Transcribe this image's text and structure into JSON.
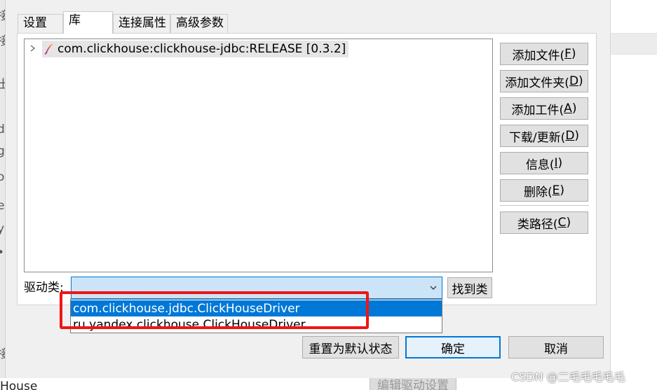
{
  "background": {
    "left_edge_chars": [
      "接",
      "接",
      "出",
      "d",
      "g",
      "oi",
      "e",
      "y",
      "•",
      "接"
    ],
    "bottom_text": "House",
    "edit_driver_button": "编辑驱动设置"
  },
  "tabs": [
    {
      "label": "设置"
    },
    {
      "label": "库"
    },
    {
      "label": "连接属性"
    },
    {
      "label": "高级参数"
    }
  ],
  "library_tree": {
    "items": [
      {
        "label": "com.clickhouse:clickhouse-jdbc:RELEASE [0.3.2]",
        "icon": "maven-feather-icon"
      }
    ]
  },
  "side_buttons": {
    "add_file": {
      "label": "添加文件(",
      "key": "F",
      "suffix": ")"
    },
    "add_folder": {
      "label": "添加文件夹(",
      "key": "D",
      "suffix": ")"
    },
    "add_artifact": {
      "label": "添加工件(",
      "key": "A",
      "suffix": ")"
    },
    "download": {
      "label": "下载/更新(",
      "key": "D",
      "suffix": ")"
    },
    "info": {
      "label": "信息(",
      "key": "I",
      "suffix": ")"
    },
    "delete": {
      "label": "删除(",
      "key": "E",
      "suffix": ")"
    },
    "classpath": {
      "label": "类路径(",
      "key": "C",
      "suffix": ")"
    }
  },
  "driver_class": {
    "label": "驱动类:",
    "selected_value": "",
    "find_button": "找到类",
    "options": [
      "com.clickhouse.jdbc.ClickHouseDriver",
      "ru.yandex.clickhouse.ClickHouseDriver"
    ]
  },
  "footer": {
    "reset": "重置为默认状态",
    "ok": "确定",
    "cancel": "取消"
  },
  "watermark": "CSDN @二毛毛毛毛毛",
  "colors": {
    "selection_blue": "#0078d7",
    "highlight_red": "#f11414",
    "feather_top": "#e8443c",
    "feather_bottom": "#9b2fae"
  }
}
